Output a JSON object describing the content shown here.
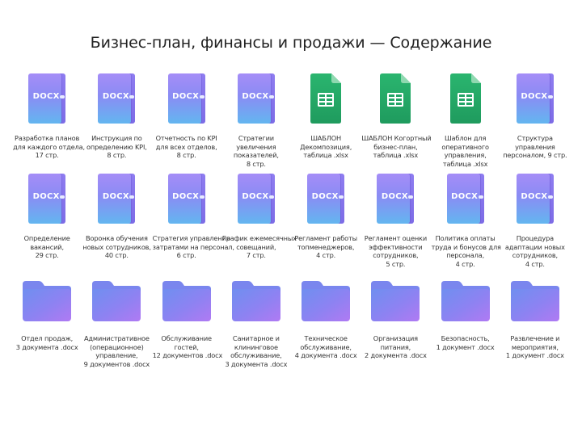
{
  "page_title": "Бизнес-план, финансы и продажи — Содержание",
  "colors": {
    "docx_top": "#a58df7",
    "docx_bottom": "#63b6f0",
    "sheet_green": "#22a566",
    "folder_top": "#7f86ef",
    "folder_bottom": "#a67cf3"
  },
  "rows": [
    [
      {
        "type": "docx",
        "icon": "docx-icon",
        "tag": "DOCX",
        "lines": [
          "Разработка планов",
          "для каждого отдела,",
          "17 стр."
        ]
      },
      {
        "type": "docx",
        "icon": "docx-icon",
        "tag": "DOCX",
        "lines": [
          "Инструкция по",
          "определению KPI,",
          "8 стр."
        ]
      },
      {
        "type": "docx",
        "icon": "docx-icon",
        "tag": "DOCX",
        "lines": [
          "Отчетность по KPI",
          "для всех отделов,",
          "8 стр."
        ]
      },
      {
        "type": "docx",
        "icon": "docx-icon",
        "tag": "DOCX",
        "lines": [
          "Стратегии",
          "увеличения",
          "показателей,",
          "8 стр."
        ]
      },
      {
        "type": "sheet",
        "icon": "spreadsheet-icon",
        "lines": [
          "ШАБЛОН",
          "Декомпозиция,",
          "таблица .xlsx"
        ]
      },
      {
        "type": "sheet",
        "icon": "spreadsheet-icon",
        "lines": [
          "ШАБЛОН Когортный",
          "бизнес-план,",
          "таблица .xlsx"
        ]
      },
      {
        "type": "sheet",
        "icon": "spreadsheet-icon",
        "lines": [
          "Шаблон для",
          "оперативного",
          "управления,",
          "таблица .xlsx"
        ]
      },
      {
        "type": "docx",
        "icon": "docx-icon",
        "tag": "DOCX",
        "lines": [
          "Структура",
          "управления",
          "персоналом, 9 стр."
        ]
      }
    ],
    [
      {
        "type": "docx",
        "icon": "docx-icon",
        "tag": "DOCX",
        "lines": [
          "Определение",
          "вакансий,",
          "29 стр."
        ]
      },
      {
        "type": "docx",
        "icon": "docx-icon",
        "tag": "DOCX",
        "lines": [
          "Воронка обучения",
          "новых сотрудников,",
          "40 стр."
        ]
      },
      {
        "type": "docx",
        "icon": "docx-icon",
        "tag": "DOCX",
        "lines": [
          "Стратегия управления",
          "затратами на персонал,",
          "6 стр."
        ]
      },
      {
        "type": "docx",
        "icon": "docx-icon",
        "tag": "DOCX",
        "lines": [
          "График ежемесячных",
          "совещаний,",
          "7 стр."
        ]
      },
      {
        "type": "docx",
        "icon": "docx-icon",
        "tag": "DOCX",
        "lines": [
          "Регламент работы",
          "топменеджеров,",
          "4 стр."
        ]
      },
      {
        "type": "docx",
        "icon": "docx-icon",
        "tag": "DOCX",
        "lines": [
          "Регламент оценки",
          "эффективности",
          "сотрудников,",
          "5 стр."
        ]
      },
      {
        "type": "docx",
        "icon": "docx-icon",
        "tag": "DOCX",
        "lines": [
          "Политика оплаты",
          "труда и бонусов для",
          "персонала,",
          "4 стр."
        ]
      },
      {
        "type": "docx",
        "icon": "docx-icon",
        "tag": "DOCX",
        "lines": [
          "Процедура",
          "адаптации новых",
          "сотрудников,",
          "4 стр."
        ]
      }
    ],
    [
      {
        "type": "folder",
        "icon": "folder-icon",
        "lines": [
          "Отдел продаж,",
          "3 документа .docx"
        ]
      },
      {
        "type": "folder",
        "icon": "folder-icon",
        "lines": [
          "Административное",
          "(операционное)",
          "управление,",
          "9 документов .docx"
        ]
      },
      {
        "type": "folder",
        "icon": "folder-icon",
        "lines": [
          "Обслуживание",
          "гостей,",
          "12 документов .docx"
        ]
      },
      {
        "type": "folder",
        "icon": "folder-icon",
        "lines": [
          "Санитарное и",
          "клининговое",
          "обслуживание,",
          "3 документа .docx"
        ]
      },
      {
        "type": "folder",
        "icon": "folder-icon",
        "lines": [
          "Техническое",
          "обслуживание,",
          "4 документа .docx"
        ]
      },
      {
        "type": "folder",
        "icon": "folder-icon",
        "lines": [
          "Организация",
          "питания,",
          "2 документа .docx"
        ]
      },
      {
        "type": "folder",
        "icon": "folder-icon",
        "lines": [
          "Безопасность,",
          "1 документ .docx"
        ]
      },
      {
        "type": "folder",
        "icon": "folder-icon",
        "lines": [
          "Развлечение и",
          "мероприятия,",
          "1 документ .docx"
        ]
      }
    ]
  ]
}
